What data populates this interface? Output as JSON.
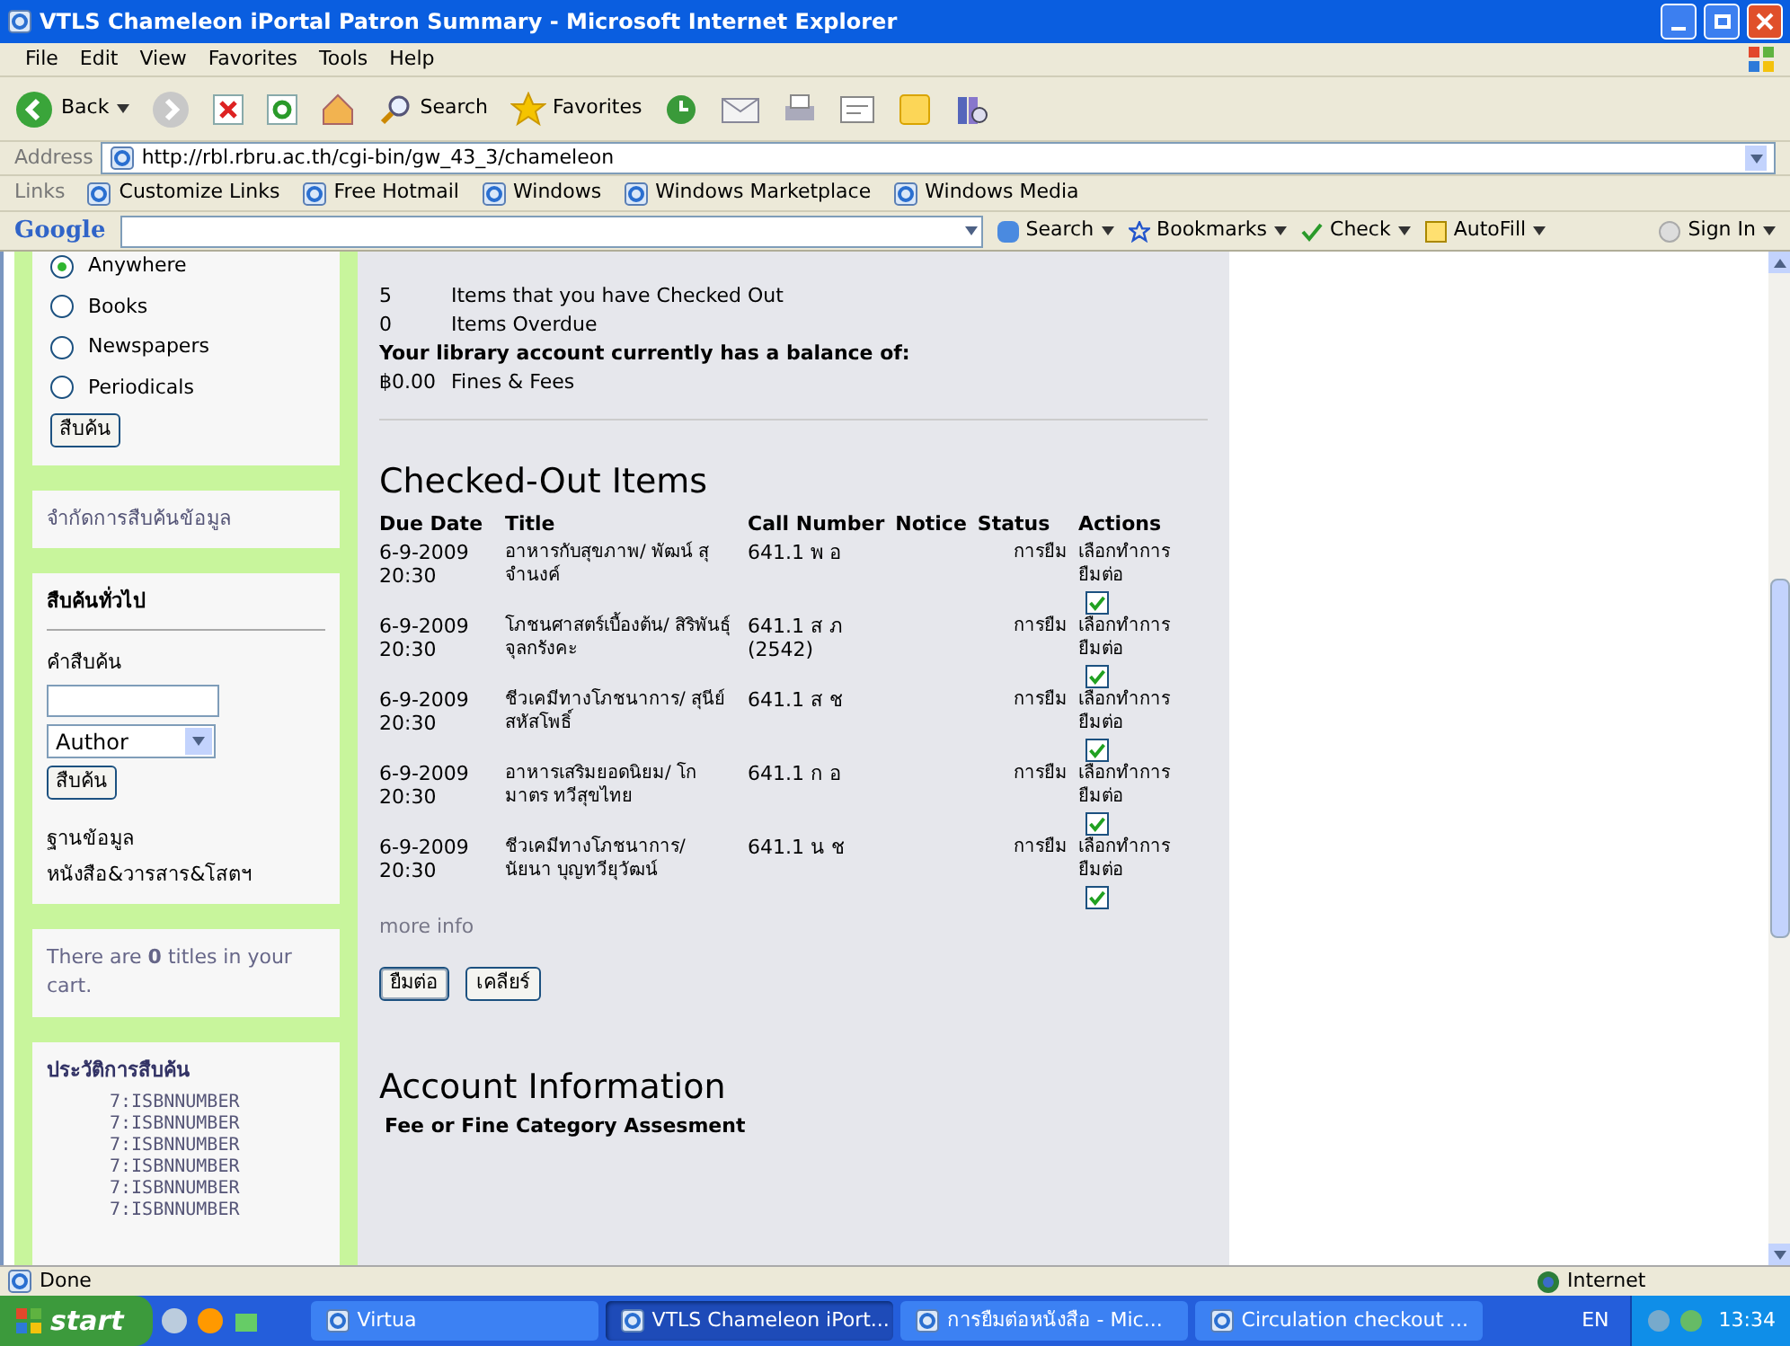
{
  "window": {
    "title": "VTLS Chameleon iPortal Patron Summary - Microsoft Internet Explorer"
  },
  "menu": [
    "File",
    "Edit",
    "View",
    "Favorites",
    "Tools",
    "Help"
  ],
  "toolbar": {
    "back": "Back",
    "search": "Search",
    "favorites": "Favorites"
  },
  "address": {
    "label": "Address",
    "url": "http://rbl.rbru.ac.th/cgi-bin/gw_43_3/chameleon"
  },
  "links": {
    "label": "Links",
    "items": [
      "Customize Links",
      "Free Hotmail",
      "Windows",
      "Windows Marketplace",
      "Windows Media"
    ]
  },
  "google_toolbar": {
    "logo": "Google",
    "search": "Search",
    "bookmarks": "Bookmarks",
    "check": "Check",
    "autofill": "AutoFill",
    "sign_in": "Sign In"
  },
  "sidebar": {
    "scopes": [
      {
        "label": "Anywhere",
        "selected": true
      },
      {
        "label": "Books",
        "selected": false
      },
      {
        "label": "Newspapers",
        "selected": false
      },
      {
        "label": "Periodicals",
        "selected": false
      }
    ],
    "scope_button": "สืบค้น",
    "limit_link": "จำกัดการสืบค้นข้อมูล",
    "general_search": {
      "title": "สืบค้นทั่วไป",
      "term_label": "คำสืบค้น",
      "field": "Author",
      "button": "สืบค้น",
      "database_label": "ฐานข้อมูล",
      "database": "หนังสือ&วารสาร&โสตฯ"
    },
    "cart": "There are **0** titles in your cart.",
    "history": {
      "title": "ประวัติการสืบค้น",
      "items": [
        "7:ISBNNUMBER",
        "7:ISBNNUMBER",
        "7:ISBNNUMBER",
        "7:ISBNNUMBER",
        "7:ISBNNUMBER",
        "7:ISBNNUMBER"
      ]
    }
  },
  "summary": [
    {
      "count": "5",
      "label": "Items that you have Checked Out"
    },
    {
      "count": "0",
      "label": "Items Overdue"
    }
  ],
  "balance": {
    "heading": "Your library account currently has a balance of:",
    "amount": "฿0.00",
    "label": "Fines & Fees"
  },
  "checked_out": {
    "title": "Checked-Out Items",
    "columns": [
      "Due Date",
      "Title",
      "Call Number",
      "Notice",
      "Status",
      "Actions"
    ],
    "rows": [
      {
        "due": "6-9-2009 20:30",
        "title": "อาหารกับสุขภาพ/ พัฒน์ สุจำนงค์",
        "call_number": "641.1 พ อ",
        "status": "การยืม",
        "action": "เลือกทำการยืมต่อ",
        "checked": true
      },
      {
        "due": "6-9-2009 20:30",
        "title": "โภชนศาสตร์เบื้องต้น/ สิริพันธุ์ จุลกรังคะ",
        "call_number": "641.1 ส ภ (2542)",
        "status": "การยืม",
        "action": "เลือกทำการยืมต่อ",
        "checked": true
      },
      {
        "due": "6-9-2009 20:30",
        "title": "ชีวเคมีทางโภชนาการ/ สุนีย์ สหัสโพธิ์",
        "call_number": "641.1 ส ช",
        "status": "การยืม",
        "action": "เลือกทำการยืมต่อ",
        "checked": true
      },
      {
        "due": "6-9-2009 20:30",
        "title": "อาหารเสริมยอดนิยม/ โกมาตร ทวีสุขไทย",
        "call_number": "641.1 ก อ",
        "status": "การยืม",
        "action": "เลือกทำการยืมต่อ",
        "checked": true
      },
      {
        "due": "6-9-2009 20:30",
        "title": "ชีวเคมีทางโภชนาการ/ นัยนา บุญทวียุวัฒน์",
        "call_number": "641.1 น ช",
        "status": "การยืม",
        "action": "เลือกทำการยืมต่อ",
        "checked": true
      }
    ],
    "more_info": "more info",
    "buttons": [
      "ยืมต่อ",
      "เคลียร์"
    ]
  },
  "account": {
    "title": "Account Information",
    "subtitle": "Fee or Fine Category Assesment"
  },
  "status_bar": {
    "text": "Done",
    "zone": "Internet"
  },
  "taskbar": {
    "start": "start",
    "tasks": [
      {
        "label": "Virtua",
        "selected": false
      },
      {
        "label": "VTLS Chameleon iPort...",
        "selected": true
      },
      {
        "label": "การยืมต่อหนังสือ - Mic...",
        "selected": false
      },
      {
        "label": "Circulation checkout ...",
        "selected": false
      }
    ],
    "language": "EN",
    "clock": "13:34"
  }
}
